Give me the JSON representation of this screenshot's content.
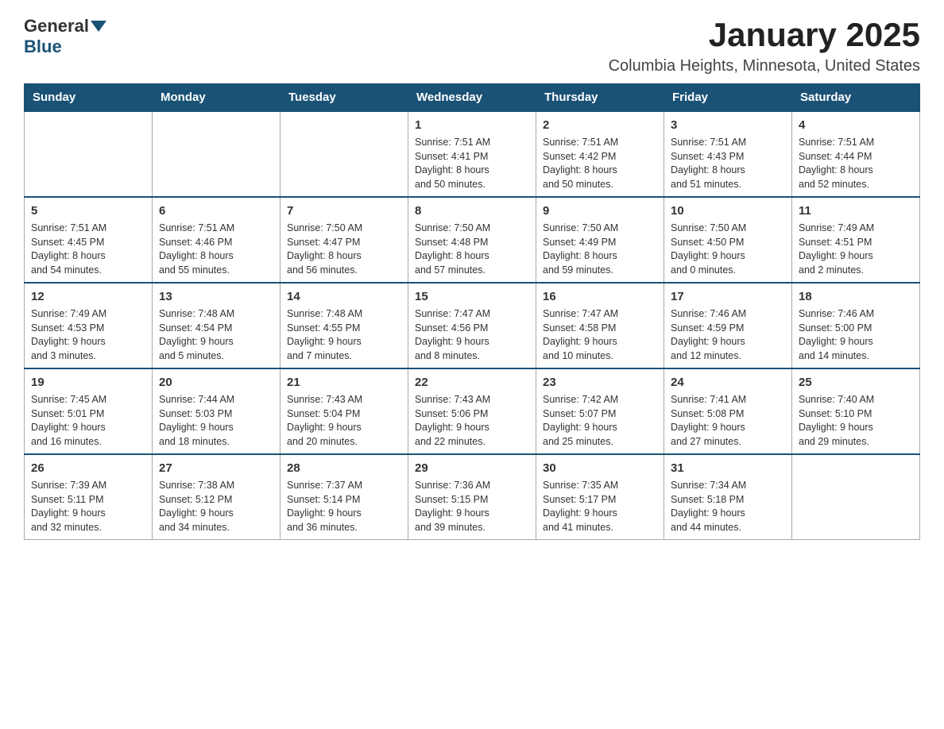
{
  "header": {
    "logo_general": "General",
    "logo_blue": "Blue",
    "title": "January 2025",
    "subtitle": "Columbia Heights, Minnesota, United States"
  },
  "days_of_week": [
    "Sunday",
    "Monday",
    "Tuesday",
    "Wednesday",
    "Thursday",
    "Friday",
    "Saturday"
  ],
  "weeks": [
    [
      {
        "day": "",
        "info": ""
      },
      {
        "day": "",
        "info": ""
      },
      {
        "day": "",
        "info": ""
      },
      {
        "day": "1",
        "info": "Sunrise: 7:51 AM\nSunset: 4:41 PM\nDaylight: 8 hours\nand 50 minutes."
      },
      {
        "day": "2",
        "info": "Sunrise: 7:51 AM\nSunset: 4:42 PM\nDaylight: 8 hours\nand 50 minutes."
      },
      {
        "day": "3",
        "info": "Sunrise: 7:51 AM\nSunset: 4:43 PM\nDaylight: 8 hours\nand 51 minutes."
      },
      {
        "day": "4",
        "info": "Sunrise: 7:51 AM\nSunset: 4:44 PM\nDaylight: 8 hours\nand 52 minutes."
      }
    ],
    [
      {
        "day": "5",
        "info": "Sunrise: 7:51 AM\nSunset: 4:45 PM\nDaylight: 8 hours\nand 54 minutes."
      },
      {
        "day": "6",
        "info": "Sunrise: 7:51 AM\nSunset: 4:46 PM\nDaylight: 8 hours\nand 55 minutes."
      },
      {
        "day": "7",
        "info": "Sunrise: 7:50 AM\nSunset: 4:47 PM\nDaylight: 8 hours\nand 56 minutes."
      },
      {
        "day": "8",
        "info": "Sunrise: 7:50 AM\nSunset: 4:48 PM\nDaylight: 8 hours\nand 57 minutes."
      },
      {
        "day": "9",
        "info": "Sunrise: 7:50 AM\nSunset: 4:49 PM\nDaylight: 8 hours\nand 59 minutes."
      },
      {
        "day": "10",
        "info": "Sunrise: 7:50 AM\nSunset: 4:50 PM\nDaylight: 9 hours\nand 0 minutes."
      },
      {
        "day": "11",
        "info": "Sunrise: 7:49 AM\nSunset: 4:51 PM\nDaylight: 9 hours\nand 2 minutes."
      }
    ],
    [
      {
        "day": "12",
        "info": "Sunrise: 7:49 AM\nSunset: 4:53 PM\nDaylight: 9 hours\nand 3 minutes."
      },
      {
        "day": "13",
        "info": "Sunrise: 7:48 AM\nSunset: 4:54 PM\nDaylight: 9 hours\nand 5 minutes."
      },
      {
        "day": "14",
        "info": "Sunrise: 7:48 AM\nSunset: 4:55 PM\nDaylight: 9 hours\nand 7 minutes."
      },
      {
        "day": "15",
        "info": "Sunrise: 7:47 AM\nSunset: 4:56 PM\nDaylight: 9 hours\nand 8 minutes."
      },
      {
        "day": "16",
        "info": "Sunrise: 7:47 AM\nSunset: 4:58 PM\nDaylight: 9 hours\nand 10 minutes."
      },
      {
        "day": "17",
        "info": "Sunrise: 7:46 AM\nSunset: 4:59 PM\nDaylight: 9 hours\nand 12 minutes."
      },
      {
        "day": "18",
        "info": "Sunrise: 7:46 AM\nSunset: 5:00 PM\nDaylight: 9 hours\nand 14 minutes."
      }
    ],
    [
      {
        "day": "19",
        "info": "Sunrise: 7:45 AM\nSunset: 5:01 PM\nDaylight: 9 hours\nand 16 minutes."
      },
      {
        "day": "20",
        "info": "Sunrise: 7:44 AM\nSunset: 5:03 PM\nDaylight: 9 hours\nand 18 minutes."
      },
      {
        "day": "21",
        "info": "Sunrise: 7:43 AM\nSunset: 5:04 PM\nDaylight: 9 hours\nand 20 minutes."
      },
      {
        "day": "22",
        "info": "Sunrise: 7:43 AM\nSunset: 5:06 PM\nDaylight: 9 hours\nand 22 minutes."
      },
      {
        "day": "23",
        "info": "Sunrise: 7:42 AM\nSunset: 5:07 PM\nDaylight: 9 hours\nand 25 minutes."
      },
      {
        "day": "24",
        "info": "Sunrise: 7:41 AM\nSunset: 5:08 PM\nDaylight: 9 hours\nand 27 minutes."
      },
      {
        "day": "25",
        "info": "Sunrise: 7:40 AM\nSunset: 5:10 PM\nDaylight: 9 hours\nand 29 minutes."
      }
    ],
    [
      {
        "day": "26",
        "info": "Sunrise: 7:39 AM\nSunset: 5:11 PM\nDaylight: 9 hours\nand 32 minutes."
      },
      {
        "day": "27",
        "info": "Sunrise: 7:38 AM\nSunset: 5:12 PM\nDaylight: 9 hours\nand 34 minutes."
      },
      {
        "day": "28",
        "info": "Sunrise: 7:37 AM\nSunset: 5:14 PM\nDaylight: 9 hours\nand 36 minutes."
      },
      {
        "day": "29",
        "info": "Sunrise: 7:36 AM\nSunset: 5:15 PM\nDaylight: 9 hours\nand 39 minutes."
      },
      {
        "day": "30",
        "info": "Sunrise: 7:35 AM\nSunset: 5:17 PM\nDaylight: 9 hours\nand 41 minutes."
      },
      {
        "day": "31",
        "info": "Sunrise: 7:34 AM\nSunset: 5:18 PM\nDaylight: 9 hours\nand 44 minutes."
      },
      {
        "day": "",
        "info": ""
      }
    ]
  ]
}
